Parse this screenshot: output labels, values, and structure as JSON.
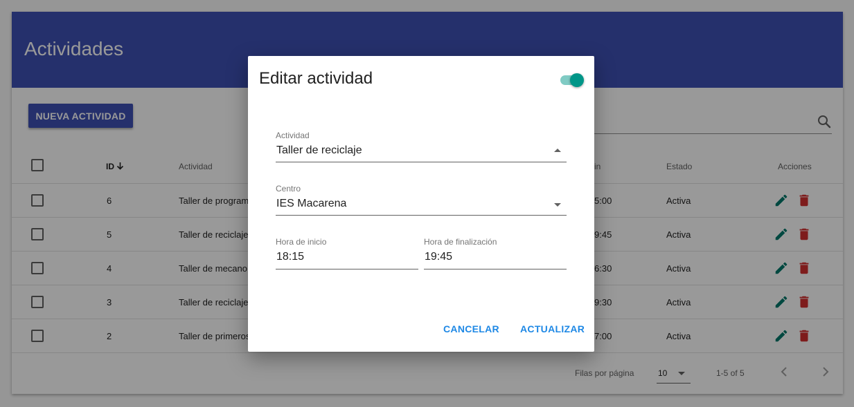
{
  "page": {
    "title": "Actividades"
  },
  "toolbar": {
    "new_label": "NUEVA ACTIVIDAD"
  },
  "search": {
    "icon": "search-icon"
  },
  "table": {
    "headers": {
      "id": "ID",
      "activity": "Actividad",
      "end": "in",
      "status": "Estado",
      "actions": "Acciones"
    },
    "sort_icon": "arrow-down-icon",
    "rows": [
      {
        "id": "6",
        "activity": "Taller de program",
        "end": "5:00",
        "status": "Activa"
      },
      {
        "id": "5",
        "activity": "Taller de reciclaje",
        "end": "9:45",
        "status": "Activa"
      },
      {
        "id": "4",
        "activity": "Taller de mecano",
        "end": "6:30",
        "status": "Activa"
      },
      {
        "id": "3",
        "activity": "Taller de reciclaje",
        "end": "9:30",
        "status": "Activa"
      },
      {
        "id": "2",
        "activity": "Taller de primeros",
        "end": "7:00",
        "status": "Activa"
      }
    ]
  },
  "pagination": {
    "rows_label": "Filas por página",
    "rows_value": "10",
    "range": "1-5 of 5"
  },
  "dialog": {
    "title": "Editar actividad",
    "toggle_on": true,
    "activity_label": "Actividad",
    "activity_value": "Taller de reciclaje",
    "center_label": "Centro",
    "center_value": "IES Macarena",
    "start_label": "Hora de inicio",
    "start_value": "18:15",
    "end_label": "Hora de finalización",
    "end_value": "19:45",
    "cancel": "CANCELAR",
    "update": "ACTUALIZAR"
  },
  "colors": {
    "primary": "#3f51b5",
    "accent": "#009688",
    "edit": "#00796b",
    "delete": "#d32f2f",
    "link": "#1e88e5"
  }
}
